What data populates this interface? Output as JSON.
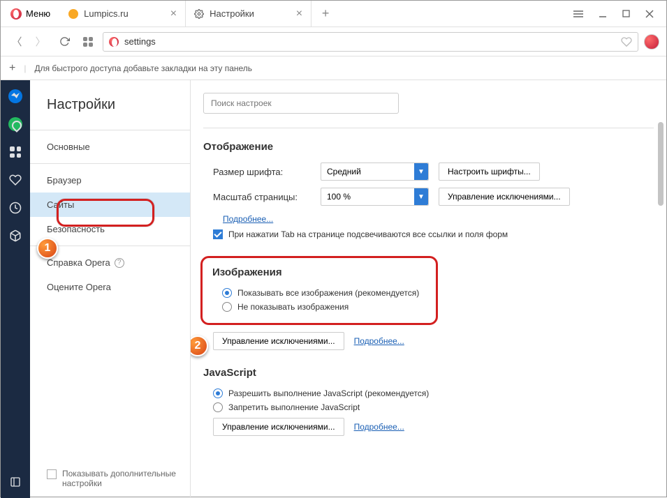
{
  "titlebar": {
    "menu_label": "Меню",
    "tabs": [
      {
        "label": "Lumpics.ru"
      },
      {
        "label": "Настройки"
      }
    ]
  },
  "addressbar": {
    "value": "settings"
  },
  "bookmark_hint": "Для быстрого доступа добавьте закладки на эту панель",
  "sidebar": {
    "title": "Настройки",
    "items": [
      {
        "label": "Основные"
      },
      {
        "label": "Браузер"
      },
      {
        "label": "Сайты"
      },
      {
        "label": "Безопасность"
      },
      {
        "label": "Справка Opera"
      },
      {
        "label": "Оцените Opera"
      }
    ],
    "show_advanced": "Показывать дополнительные настройки"
  },
  "content": {
    "search_placeholder": "Поиск настроек",
    "display": {
      "title": "Отображение",
      "font_size_label": "Размер шрифта:",
      "font_size_value": "Средний",
      "font_button": "Настроить шрифты...",
      "zoom_label": "Масштаб страницы:",
      "zoom_value": "100 %",
      "zoom_button": "Управление исключениями...",
      "more": "Подробнее...",
      "tab_highlight": "При нажатии Tab на странице подсвечиваются все ссылки и поля форм"
    },
    "images": {
      "title": "Изображения",
      "show_all": "Показывать все изображения (рекомендуется)",
      "dont_show": "Не показывать изображения",
      "manage": "Управление исключениями...",
      "more": "Подробнее..."
    },
    "javascript": {
      "title": "JavaScript",
      "allow": "Разрешить выполнение JavaScript (рекомендуется)",
      "deny": "Запретить выполнение JavaScript",
      "manage": "Управление исключениями...",
      "more": "Подробнее..."
    }
  },
  "badges": {
    "one": "1",
    "two": "2"
  }
}
